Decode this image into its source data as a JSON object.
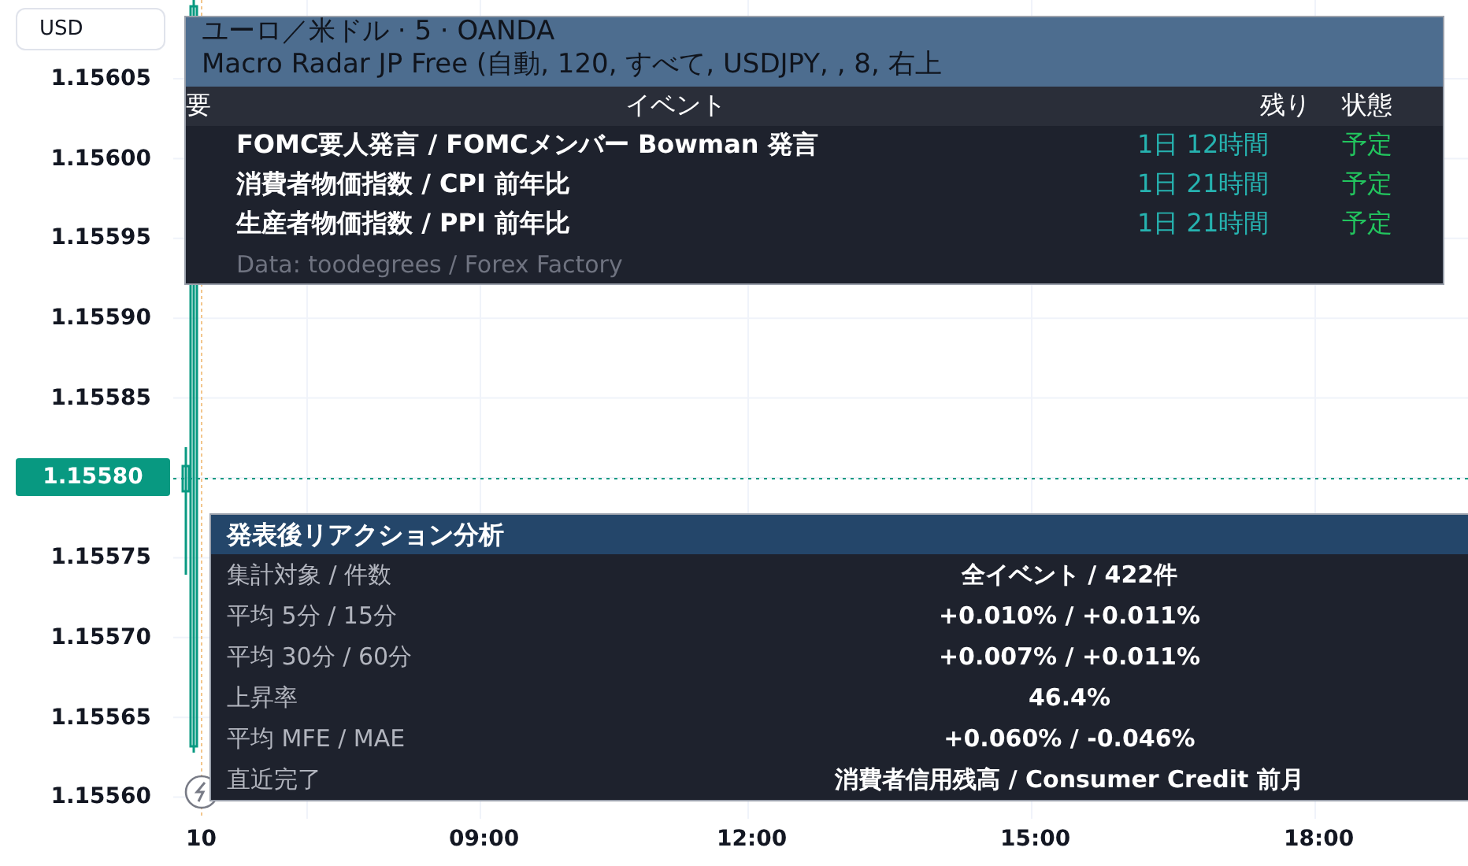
{
  "price_axis": {
    "unit": "USD",
    "labels": [
      {
        "text": "1.15605",
        "current": false
      },
      {
        "text": "1.15600",
        "current": false
      },
      {
        "text": "1.15595",
        "current": false
      },
      {
        "text": "1.15590",
        "current": false
      },
      {
        "text": "1.15585",
        "current": false
      },
      {
        "text": "1.15580",
        "current": true
      },
      {
        "text": "1.15575",
        "current": false
      },
      {
        "text": "1.15570",
        "current": false
      },
      {
        "text": "1.15565",
        "current": false
      },
      {
        "text": "1.15560",
        "current": false
      }
    ]
  },
  "legend": {
    "symbol": "ユーロ／米ドル · 5 · OANDA",
    "indicator": "Macro Radar JP Free (自動, 120, すべて, USDJPY, , 8, 右上"
  },
  "events_table": {
    "columns": [
      "要",
      "イベント",
      "残り",
      "状態"
    ],
    "rows": [
      {
        "event": "FOMC要人発言 / FOMCメンバー Bowman 発言",
        "remaining": "1日 12時間",
        "status": "予定"
      },
      {
        "event": "消費者物価指数 / CPI 前年比",
        "remaining": "1日 21時間",
        "status": "予定"
      },
      {
        "event": "生産者物価指数 / PPI 前年比",
        "remaining": "1日 21時間",
        "status": "予定"
      }
    ],
    "footer": "Data: toodegrees / Forex Factory"
  },
  "reaction_panel": {
    "title": "発表後リアクション分析",
    "rows": [
      {
        "label": "集計対象 / 件数",
        "value": "全イベント / 422件"
      },
      {
        "label": "平均 5分 / 15分",
        "value": "+0.010% / +0.011%"
      },
      {
        "label": "平均 30分 / 60分",
        "value": "+0.007% / +0.011%"
      },
      {
        "label": "上昇率",
        "value": "46.4%"
      },
      {
        "label": "平均 MFE / MAE",
        "value": "+0.060% / -0.046%"
      },
      {
        "label": "直近完了",
        "value": "消費者信用残高 / Consumer Credit 前月"
      }
    ]
  },
  "time_axis": [
    "10",
    "09:00",
    "12:00",
    "15:00",
    "18:00"
  ]
}
